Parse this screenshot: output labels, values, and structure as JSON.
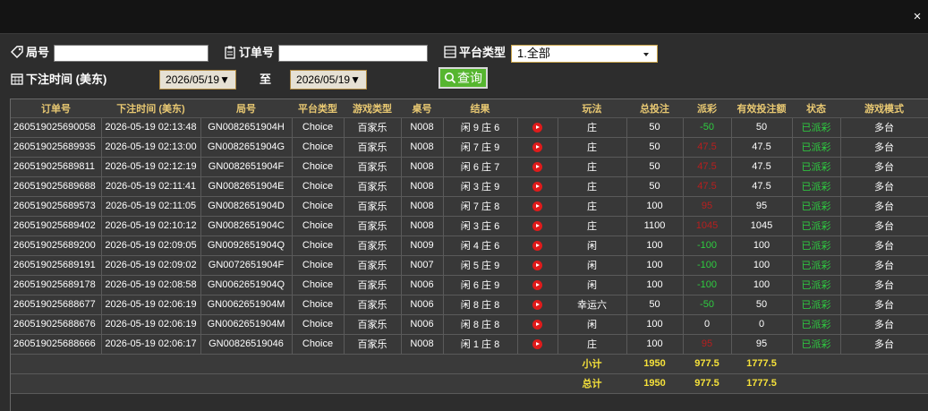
{
  "window": {
    "close_label": "×"
  },
  "filters": {
    "round_label": "局号",
    "round_value": "",
    "order_label": "订单号",
    "order_value": "",
    "platform_label": "平台类型",
    "platform_value": "1.全部",
    "bettime_label": "下注时间 (美东)",
    "date_from": "2026/05/19▼",
    "to_label": "至",
    "date_to": "2026/05/19▼",
    "query_label": "查询"
  },
  "columns": [
    "订单号",
    "下注时间 (美东)",
    "局号",
    "平台类型",
    "游戏类型",
    "桌号",
    "结果",
    "",
    "玩法",
    "总投注",
    "派彩",
    "有效投注额",
    "状态",
    "游戏模式"
  ],
  "rows": [
    {
      "order": "260519025690058",
      "time": "2026-05-19 02:13:48",
      "round": "GN0082651904H",
      "platform": "Choice",
      "game": "百家乐",
      "table": "N008",
      "result": "闲 9 庄 6",
      "play": "庄",
      "bet": "50",
      "payout": "-50",
      "payout_color": "win",
      "valid": "50",
      "status": "已派彩",
      "mode": "多台"
    },
    {
      "order": "260519025689935",
      "time": "2026-05-19 02:13:00",
      "round": "GN0082651904G",
      "platform": "Choice",
      "game": "百家乐",
      "table": "N008",
      "result": "闲 7 庄 9",
      "play": "庄",
      "bet": "50",
      "payout": "47.5",
      "payout_color": "loss",
      "valid": "47.5",
      "status": "已派彩",
      "mode": "多台"
    },
    {
      "order": "260519025689811",
      "time": "2026-05-19 02:12:19",
      "round": "GN0082651904F",
      "platform": "Choice",
      "game": "百家乐",
      "table": "N008",
      "result": "闲 6 庄 7",
      "play": "庄",
      "bet": "50",
      "payout": "47.5",
      "payout_color": "loss",
      "valid": "47.5",
      "status": "已派彩",
      "mode": "多台"
    },
    {
      "order": "260519025689688",
      "time": "2026-05-19 02:11:41",
      "round": "GN0082651904E",
      "platform": "Choice",
      "game": "百家乐",
      "table": "N008",
      "result": "闲 3 庄 9",
      "play": "庄",
      "bet": "50",
      "payout": "47.5",
      "payout_color": "loss",
      "valid": "47.5",
      "status": "已派彩",
      "mode": "多台"
    },
    {
      "order": "260519025689573",
      "time": "2026-05-19 02:11:05",
      "round": "GN0082651904D",
      "platform": "Choice",
      "game": "百家乐",
      "table": "N008",
      "result": "闲 7 庄 8",
      "play": "庄",
      "bet": "100",
      "payout": "95",
      "payout_color": "loss",
      "valid": "95",
      "status": "已派彩",
      "mode": "多台"
    },
    {
      "order": "260519025689402",
      "time": "2026-05-19 02:10:12",
      "round": "GN0082651904C",
      "platform": "Choice",
      "game": "百家乐",
      "table": "N008",
      "result": "闲 3 庄 6",
      "play": "庄",
      "bet": "1100",
      "payout": "1045",
      "payout_color": "loss",
      "valid": "1045",
      "status": "已派彩",
      "mode": "多台"
    },
    {
      "order": "260519025689200",
      "time": "2026-05-19 02:09:05",
      "round": "GN0092651904Q",
      "platform": "Choice",
      "game": "百家乐",
      "table": "N009",
      "result": "闲 4 庄 6",
      "play": "闲",
      "bet": "100",
      "payout": "-100",
      "payout_color": "win",
      "valid": "100",
      "status": "已派彩",
      "mode": "多台"
    },
    {
      "order": "260519025689191",
      "time": "2026-05-19 02:09:02",
      "round": "GN0072651904F",
      "platform": "Choice",
      "game": "百家乐",
      "table": "N007",
      "result": "闲 5 庄 9",
      "play": "闲",
      "bet": "100",
      "payout": "-100",
      "payout_color": "win",
      "valid": "100",
      "status": "已派彩",
      "mode": "多台"
    },
    {
      "order": "260519025689178",
      "time": "2026-05-19 02:08:58",
      "round": "GN0062651904Q",
      "platform": "Choice",
      "game": "百家乐",
      "table": "N006",
      "result": "闲 6 庄 9",
      "play": "闲",
      "bet": "100",
      "payout": "-100",
      "payout_color": "win",
      "valid": "100",
      "status": "已派彩",
      "mode": "多台"
    },
    {
      "order": "260519025688677",
      "time": "2026-05-19 02:06:19",
      "round": "GN0062651904M",
      "platform": "Choice",
      "game": "百家乐",
      "table": "N006",
      "result": "闲 8 庄 8",
      "play": "幸运六",
      "bet": "50",
      "payout": "-50",
      "payout_color": "win",
      "valid": "50",
      "status": "已派彩",
      "mode": "多台"
    },
    {
      "order": "260519025688676",
      "time": "2026-05-19 02:06:19",
      "round": "GN0062651904M",
      "platform": "Choice",
      "game": "百家乐",
      "table": "N006",
      "result": "闲 8 庄 8",
      "play": "闲",
      "bet": "100",
      "payout": "0",
      "payout_color": "plain",
      "valid": "0",
      "status": "已派彩",
      "mode": "多台"
    },
    {
      "order": "260519025688666",
      "time": "2026-05-19 02:06:17",
      "round": "GN00826519046",
      "platform": "Choice",
      "game": "百家乐",
      "table": "N008",
      "result": "闲 1 庄 8",
      "play": "庄",
      "bet": "100",
      "payout": "95",
      "payout_color": "loss",
      "valid": "95",
      "status": "已派彩",
      "mode": "多台"
    }
  ],
  "subtotal": {
    "label": "小计",
    "bet": "1950",
    "payout": "977.5",
    "valid": "1777.5"
  },
  "total": {
    "label": "总计",
    "bet": "1950",
    "payout": "977.5",
    "valid": "1777.5"
  },
  "colors": {
    "win": "#2ecc40",
    "loss": "#b81f1f",
    "header_text": "#e8c872",
    "summary_text": "#f5e13a",
    "query_button": "#56b62f"
  },
  "icons": {
    "round": "tag-icon",
    "order": "clipboard-icon",
    "platform": "list-icon",
    "bettime": "calendar-icon",
    "query": "search-icon",
    "result_video": "play-icon"
  }
}
